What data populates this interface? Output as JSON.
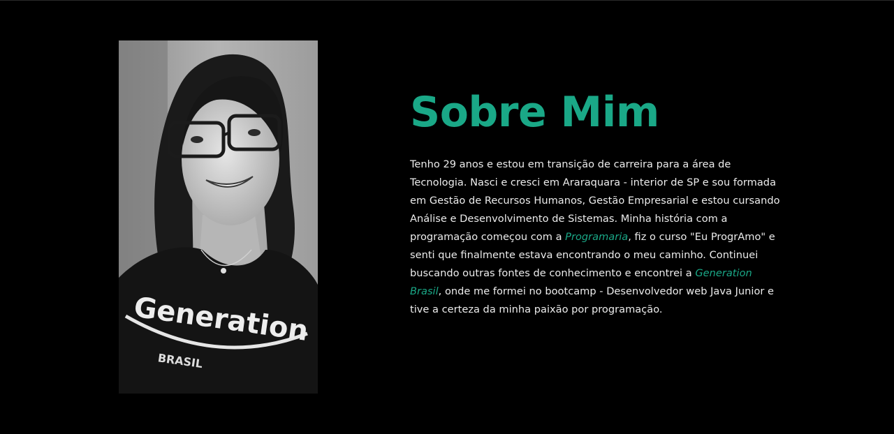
{
  "colors": {
    "accent": "#1aa887",
    "text": "#ececec",
    "background": "#000000"
  },
  "profile_photo": {
    "icon": "profile-photo",
    "shirt_text": "Generation",
    "shirt_subtext": "BRASIL"
  },
  "about": {
    "title": "Sobre Mim",
    "segments": [
      {
        "type": "text",
        "text": "Tenho 29 anos e estou em transição de carreira para a área de Tecnologia. Nasci e cresci em Araraquara - interior de SP e sou formada em Gestão de Recursos Humanos, Gestão Empresarial e estou cursando Análise e Desenvolvimento de Sistemas. Minha história com a programação começou com a "
      },
      {
        "type": "link",
        "name": "programaria-link",
        "text": "Programaria"
      },
      {
        "type": "text",
        "text": ", fiz o curso \"Eu ProgrAmo\" e senti que finalmente estava encontrando o meu caminho. Continuei buscando outras fontes de conhecimento e encontrei a "
      },
      {
        "type": "link",
        "name": "generation-brasil-link",
        "text": "Generation Brasil"
      },
      {
        "type": "text",
        "text": ", onde me formei no bootcamp - Desenvolvedor web Java Junior e tive a certeza da minha paixão por programação."
      }
    ]
  }
}
